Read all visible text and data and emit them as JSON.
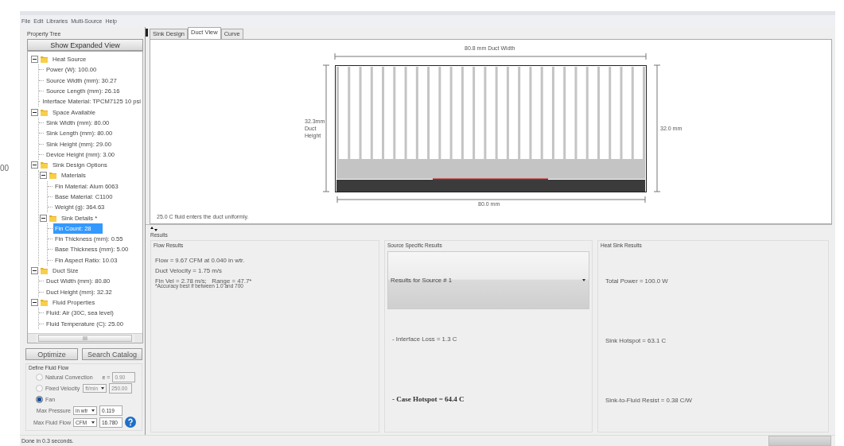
{
  "edge_text": "00",
  "menu": [
    "File",
    "Edit",
    "Libraries",
    "Multi-Source",
    "Help"
  ],
  "property_tree": {
    "title": "Property Tree",
    "expand_button": "Show Expanded View",
    "items": [
      {
        "label": "Heat Source",
        "expanded": true,
        "selected": false,
        "children": [
          {
            "label": "Power (W): 100.00",
            "selected": false
          },
          {
            "label": "Source Width (mm): 30.27",
            "selected": false
          },
          {
            "label": "Source Length (mm): 26.16",
            "selected": false
          },
          {
            "label": "Interface Material: TPCM7125 10 psi",
            "selected": false
          }
        ]
      },
      {
        "label": "Space Available",
        "expanded": true,
        "selected": false,
        "children": [
          {
            "label": "Sink Width (mm): 80.00",
            "selected": false
          },
          {
            "label": "Sink Length (mm): 80.00",
            "selected": false
          },
          {
            "label": "Sink Height (mm): 29.00",
            "selected": false
          },
          {
            "label": "Device Height (mm): 3.00",
            "selected": false
          }
        ]
      },
      {
        "label": "Sink Design Options",
        "expanded": true,
        "selected": false,
        "children": [
          {
            "label": "Materials",
            "expanded": true,
            "selected": false,
            "children": [
              {
                "label": "Fin Material: Alum 6063",
                "selected": false
              },
              {
                "label": "Base Material: C1100",
                "selected": false
              },
              {
                "label": "Weight (g): 364.63",
                "selected": false
              }
            ]
          },
          {
            "label": "Sink Details *",
            "expanded": true,
            "selected": false,
            "children": [
              {
                "label": "Fin Count: 28",
                "selected": true
              },
              {
                "label": "Fin Thickness (mm): 0.55",
                "selected": false
              },
              {
                "label": "Base Thickness (mm): 5.00",
                "selected": false
              },
              {
                "label": "Fin Aspect Ratio: 10.03",
                "selected": false
              }
            ]
          }
        ]
      },
      {
        "label": "Duct Size",
        "expanded": true,
        "selected": false,
        "children": [
          {
            "label": "Duct Width (mm): 80.80",
            "selected": false
          },
          {
            "label": "Duct Height (mm): 32.32",
            "selected": false
          }
        ]
      },
      {
        "label": "Fluid Properties",
        "expanded": true,
        "selected": false,
        "children": [
          {
            "label": "Fluid: Air (30C, sea level)",
            "selected": false
          },
          {
            "label": "Fluid Temperature (C): 25.00",
            "selected": false
          }
        ]
      }
    ],
    "scroll_thumb_mark": "III"
  },
  "buttons": [
    "Optimize",
    "Search Catalog"
  ],
  "fluid_flow": {
    "title": "Define Fluid Flow",
    "options": [
      {
        "label": "Natural Convection",
        "selected": false,
        "controls": [
          {
            "kind": "label",
            "text": "e ="
          },
          {
            "kind": "field",
            "value": "0.90",
            "disabled": true
          }
        ]
      },
      {
        "label": "Fixed Velocity",
        "selected": false,
        "controls": [
          {
            "kind": "dropdown",
            "value": "ft/min",
            "disabled": true
          },
          {
            "kind": "field",
            "value": "250.00",
            "disabled": true
          }
        ]
      },
      {
        "label": "Fan",
        "selected": true
      }
    ],
    "fan_settings": [
      {
        "label": "Max Pressure",
        "unit": "in wtr",
        "value": "0.119",
        "help": false
      },
      {
        "label": "Max Fluid Flow",
        "unit": "CFM",
        "value": "16.780",
        "help": true
      }
    ]
  },
  "tabs": [
    {
      "label": "Sink Design",
      "selected": false
    },
    {
      "label": "Duct View",
      "selected": true
    },
    {
      "label": "Curve",
      "selected": false
    }
  ],
  "duct_view": {
    "width_label": "80.8 mm Duct Width",
    "height_label": "32.3mm Duct Height",
    "sink_height_label": "32.0 mm",
    "sink_width_label": "80.0 mm",
    "note": "25.0 C fluid enters the duct uniformly."
  },
  "results": {
    "title": "Results",
    "groups": [
      {
        "title": "Flow Results",
        "kind": "stack",
        "lines": [
          {
            "text": "Flow = 9.67 CFM at 0.040 in wtr.",
            "bold": false
          },
          {
            "text": "Duct Velocity = 1.75 m/s",
            "bold": false
          },
          {
            "text": "Fin Vel = 2.78 m/s;   Range = 47.7*",
            "bold": false
          }
        ],
        "footnote": "*Accuracy best if between 1.0 and 700"
      },
      {
        "title": "Source Specific Results",
        "kind": "spread",
        "dropdown": "Results for Source # 1",
        "lines": [
          {
            "text": "- Interface Loss = 1.3 C",
            "bold": false
          },
          {
            "text": "- Case Hotspot = 64.4 C",
            "bold": true
          }
        ]
      },
      {
        "title": "Heat Sink Results",
        "kind": "spread",
        "lines": [
          {
            "text": "Total Power = 100.0 W",
            "bold": false
          },
          {
            "text": "Sink Hotspot = 63.1 C",
            "bold": false
          },
          {
            "text": "Sink-to-Fluid Resist = 0.38 C/W",
            "bold": false
          }
        ]
      }
    ]
  },
  "status_bar": {
    "text": "Done in 0.3 seconds."
  }
}
